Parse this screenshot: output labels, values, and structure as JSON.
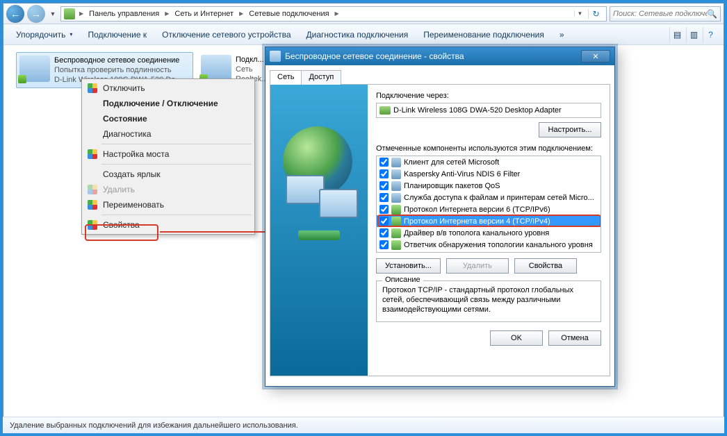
{
  "breadcrumb": {
    "b1": "Панель управления",
    "b2": "Сеть и Интернет",
    "b3": "Сетевые подключения"
  },
  "search": {
    "placeholder": "Поиск: Сетевые подключения"
  },
  "toolbar": {
    "organize": "Упорядочить",
    "connect": "Подключение к",
    "disable": "Отключение сетевого устройства",
    "diagnose": "Диагностика подключения",
    "rename": "Переименование подключения"
  },
  "conn": {
    "wifi": {
      "title": "Беспроводное сетевое соединение",
      "line2": "Попытка проверить подлинность",
      "line3": "D-Link Wireless 108G DWA-520 De..."
    },
    "lan": {
      "title": "Подкл...",
      "line2": "Сеть",
      "line3": "Realtek..."
    }
  },
  "ctx": {
    "disable": "Отключить",
    "connect": "Подключение / Отключение",
    "status": "Состояние",
    "diagnose": "Диагностика",
    "bridge": "Настройка моста",
    "shortcut": "Создать ярлык",
    "delete": "Удалить",
    "rename": "Переименовать",
    "props": "Свойства"
  },
  "dlg": {
    "title": "Беспроводное сетевое соединение - свойства",
    "tab_net": "Сеть",
    "tab_access": "Доступ",
    "connect_via": "Подключение через:",
    "adapter": "D-Link Wireless 108G DWA-520 Desktop Adapter",
    "configure": "Настроить...",
    "components_lbl": "Отмеченные компоненты используются этим подключением:",
    "c0": "Клиент для сетей Microsoft",
    "c1": "Kaspersky Anti-Virus NDIS 6 Filter",
    "c2": "Планировщик пакетов QoS",
    "c3": "Служба доступа к файлам и принтерам сетей Micro...",
    "c4": "Протокол Интернета версии 6 (TCP/IPv6)",
    "c5": "Протокол Интернета версии 4 (TCP/IPv4)",
    "c6": "Драйвер в/в тополога канального уровня",
    "c7": "Ответчик обнаружения топологии канального уровня",
    "install": "Установить...",
    "uninstall": "Удалить",
    "props": "Свойства",
    "desc_legend": "Описание",
    "desc_text": "Протокол TCP/IP - стандартный протокол глобальных сетей, обеспечивающий связь между различными взаимодействующими сетями.",
    "ok": "OK",
    "cancel": "Отмена"
  },
  "status": "Удаление выбранных подключений для избежания дальнейшего использования."
}
